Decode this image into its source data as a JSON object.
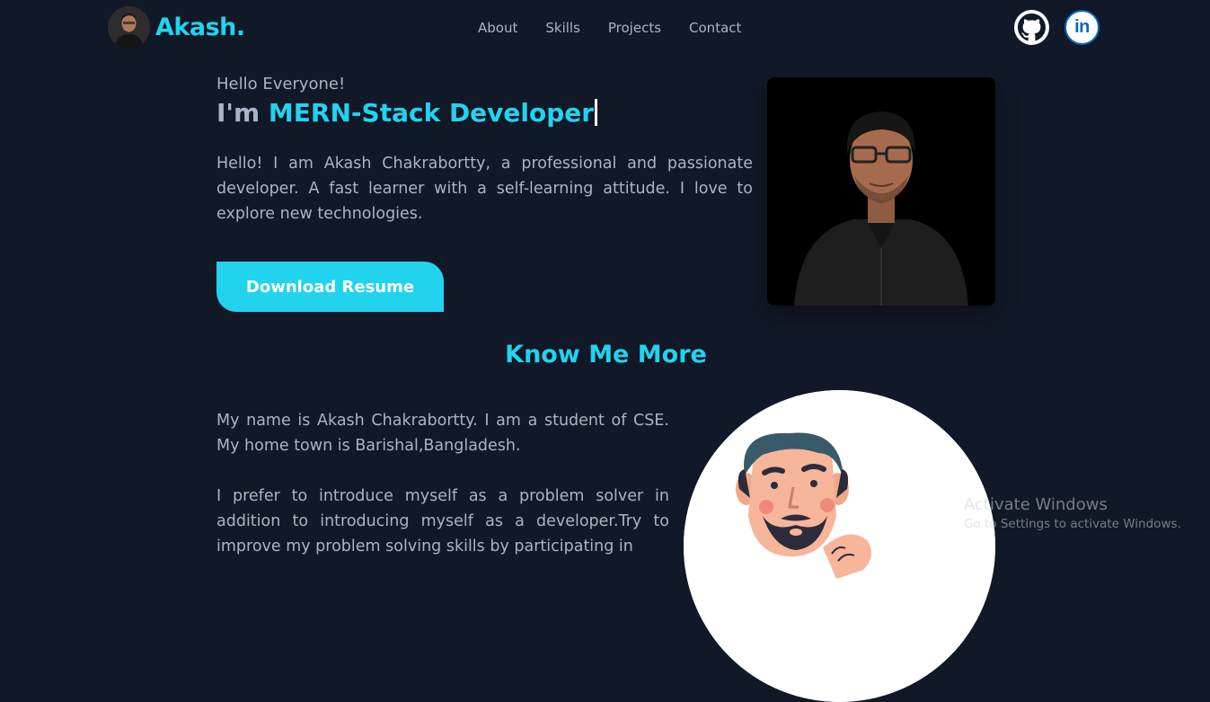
{
  "brand": {
    "name": "Akash."
  },
  "nav": {
    "items": [
      {
        "label": "About"
      },
      {
        "label": "Skills"
      },
      {
        "label": "Projects"
      },
      {
        "label": "Contact"
      }
    ],
    "social": [
      {
        "icon": "github-icon",
        "label": "GitHub"
      },
      {
        "icon": "linkedin-icon",
        "label": "in"
      }
    ]
  },
  "hero": {
    "greeting": "Hello Everyone!",
    "headline_prefix": "I'm ",
    "headline_role": "MERN-Stack Developer",
    "intro": "Hello! I am Akash Chakrabortty, a professional and passionate developer. A fast learner with a self-learning attitude. I love to explore new technologies.",
    "resume_button": "Download Resume"
  },
  "about": {
    "title": "Know Me More",
    "paragraph1": "My name is Akash Chakrabortty. I am a student of CSE. My home town is Barishal,Bangladesh.",
    "paragraph2": "I prefer to introduce myself as a problem solver in addition to introducing myself as a developer.Try to improve my problem solving skills by participating in"
  },
  "windows_watermark": {
    "title": "Activate Windows",
    "subtitle": "Go to Settings to activate Windows."
  },
  "colors": {
    "background": "#111827",
    "accent": "#22d3ee",
    "text": "#a9b4c9"
  }
}
